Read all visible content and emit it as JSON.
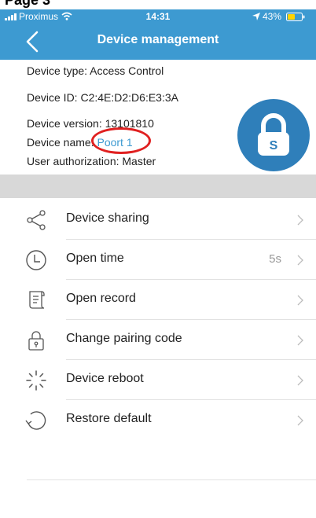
{
  "page_heading": "Page 3",
  "status_bar": {
    "carrier": "Proximus",
    "time": "14:31",
    "battery": "43%"
  },
  "nav": {
    "title": "Device management"
  },
  "info": {
    "device_type": "Device type: Access Control",
    "device_id": "Device ID: C2:4E:D2:D6:E3:3A",
    "device_version": "Device version: 13101810",
    "device_name_label": "Device name: ",
    "device_name_value": "Poort 1",
    "user_authorization": "User authorization: Master",
    "lock_letter": "S"
  },
  "menu": [
    {
      "label": "Device sharing",
      "icon": "share-icon",
      "value": ""
    },
    {
      "label": "Open time",
      "icon": "clock-icon",
      "value": "5s"
    },
    {
      "label": "Open record",
      "icon": "record-icon",
      "value": ""
    },
    {
      "label": "Change pairing code",
      "icon": "padlock-icon",
      "value": ""
    },
    {
      "label": "Device reboot",
      "icon": "reboot-icon",
      "value": ""
    },
    {
      "label": "Restore default",
      "icon": "restore-icon",
      "value": ""
    }
  ],
  "colors": {
    "header": "#3d9ad1",
    "lock_circle": "#2f7fba",
    "link": "#3d9ad1",
    "highlight": "#e02020",
    "battery": "#ffd400"
  }
}
